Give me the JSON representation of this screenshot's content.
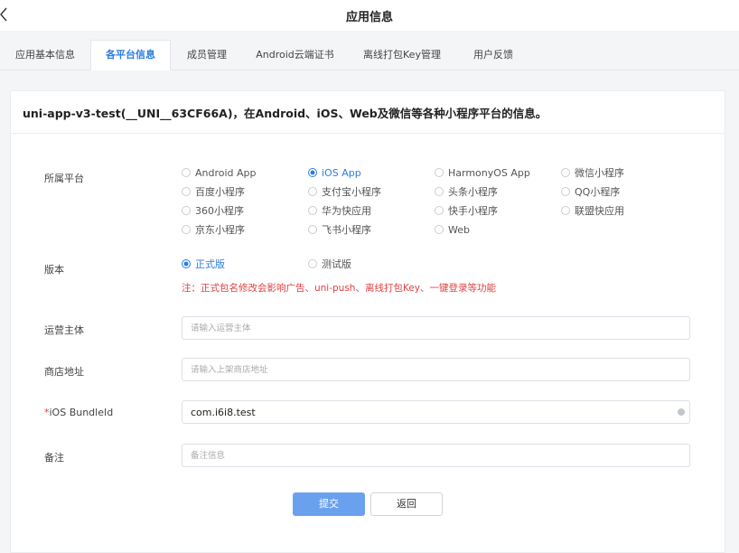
{
  "header": {
    "title": "应用信息",
    "back_icon": "chevron-left-icon"
  },
  "tabs": [
    {
      "label": "应用基本信息"
    },
    {
      "label": "各平台信息",
      "active": true
    },
    {
      "label": "成员管理"
    },
    {
      "label": "Android云端证书"
    },
    {
      "label": "离线打包Key管理"
    },
    {
      "label": "用户反馈"
    }
  ],
  "card": {
    "heading": "uni-app-v3-test(__UNI__63CF66A)，在Android、iOS、Web及微信等各种小程序平台的信息。"
  },
  "form": {
    "platform": {
      "label": "所属平台",
      "selected": "iOS App",
      "options": [
        "Android App",
        "iOS App",
        "HarmonyOS App",
        "微信小程序",
        "百度小程序",
        "支付宝小程序",
        "头条小程序",
        "QQ小程序",
        "360小程序",
        "华为快应用",
        "快手小程序",
        "联盟快应用",
        "京东小程序",
        "飞书小程序",
        "Web"
      ]
    },
    "version": {
      "label": "版本",
      "selected": "正式版",
      "options": [
        "正式版",
        "测试版"
      ],
      "note": "注：正式包名修改会影响广告、uni-push、离线打包Key、一键登录等功能"
    },
    "operator": {
      "label": "运营主体",
      "placeholder": "请输入运营主体",
      "value": ""
    },
    "store": {
      "label": "商店地址",
      "placeholder": "请输入上架商店地址",
      "value": ""
    },
    "bundle": {
      "required_mark": "*",
      "label": "iOS BundleId",
      "value": "com.i6i8.test"
    },
    "remark": {
      "label": "备注",
      "placeholder": "备注信息",
      "value": ""
    }
  },
  "buttons": {
    "submit": "提交",
    "back": "返回"
  },
  "colors": {
    "accent": "#2a7de1",
    "primary_button": "#6aa1ef",
    "error": "#e04040"
  }
}
